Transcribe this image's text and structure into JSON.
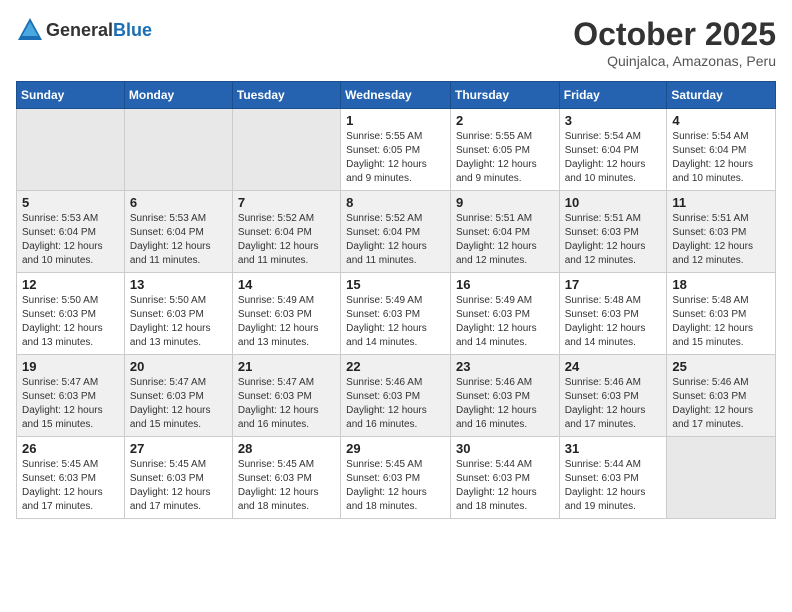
{
  "header": {
    "logo_general": "General",
    "logo_blue": "Blue",
    "title": "October 2025",
    "subtitle": "Quinjalca, Amazonas, Peru"
  },
  "days_of_week": [
    "Sunday",
    "Monday",
    "Tuesday",
    "Wednesday",
    "Thursday",
    "Friday",
    "Saturday"
  ],
  "weeks": [
    [
      {
        "day": "",
        "sunrise": "",
        "sunset": "",
        "daylight": ""
      },
      {
        "day": "",
        "sunrise": "",
        "sunset": "",
        "daylight": ""
      },
      {
        "day": "",
        "sunrise": "",
        "sunset": "",
        "daylight": ""
      },
      {
        "day": "1",
        "sunrise": "Sunrise: 5:55 AM",
        "sunset": "Sunset: 6:05 PM",
        "daylight": "Daylight: 12 hours and 9 minutes."
      },
      {
        "day": "2",
        "sunrise": "Sunrise: 5:55 AM",
        "sunset": "Sunset: 6:05 PM",
        "daylight": "Daylight: 12 hours and 9 minutes."
      },
      {
        "day": "3",
        "sunrise": "Sunrise: 5:54 AM",
        "sunset": "Sunset: 6:04 PM",
        "daylight": "Daylight: 12 hours and 10 minutes."
      },
      {
        "day": "4",
        "sunrise": "Sunrise: 5:54 AM",
        "sunset": "Sunset: 6:04 PM",
        "daylight": "Daylight: 12 hours and 10 minutes."
      }
    ],
    [
      {
        "day": "5",
        "sunrise": "Sunrise: 5:53 AM",
        "sunset": "Sunset: 6:04 PM",
        "daylight": "Daylight: 12 hours and 10 minutes."
      },
      {
        "day": "6",
        "sunrise": "Sunrise: 5:53 AM",
        "sunset": "Sunset: 6:04 PM",
        "daylight": "Daylight: 12 hours and 11 minutes."
      },
      {
        "day": "7",
        "sunrise": "Sunrise: 5:52 AM",
        "sunset": "Sunset: 6:04 PM",
        "daylight": "Daylight: 12 hours and 11 minutes."
      },
      {
        "day": "8",
        "sunrise": "Sunrise: 5:52 AM",
        "sunset": "Sunset: 6:04 PM",
        "daylight": "Daylight: 12 hours and 11 minutes."
      },
      {
        "day": "9",
        "sunrise": "Sunrise: 5:51 AM",
        "sunset": "Sunset: 6:04 PM",
        "daylight": "Daylight: 12 hours and 12 minutes."
      },
      {
        "day": "10",
        "sunrise": "Sunrise: 5:51 AM",
        "sunset": "Sunset: 6:03 PM",
        "daylight": "Daylight: 12 hours and 12 minutes."
      },
      {
        "day": "11",
        "sunrise": "Sunrise: 5:51 AM",
        "sunset": "Sunset: 6:03 PM",
        "daylight": "Daylight: 12 hours and 12 minutes."
      }
    ],
    [
      {
        "day": "12",
        "sunrise": "Sunrise: 5:50 AM",
        "sunset": "Sunset: 6:03 PM",
        "daylight": "Daylight: 12 hours and 13 minutes."
      },
      {
        "day": "13",
        "sunrise": "Sunrise: 5:50 AM",
        "sunset": "Sunset: 6:03 PM",
        "daylight": "Daylight: 12 hours and 13 minutes."
      },
      {
        "day": "14",
        "sunrise": "Sunrise: 5:49 AM",
        "sunset": "Sunset: 6:03 PM",
        "daylight": "Daylight: 12 hours and 13 minutes."
      },
      {
        "day": "15",
        "sunrise": "Sunrise: 5:49 AM",
        "sunset": "Sunset: 6:03 PM",
        "daylight": "Daylight: 12 hours and 14 minutes."
      },
      {
        "day": "16",
        "sunrise": "Sunrise: 5:49 AM",
        "sunset": "Sunset: 6:03 PM",
        "daylight": "Daylight: 12 hours and 14 minutes."
      },
      {
        "day": "17",
        "sunrise": "Sunrise: 5:48 AM",
        "sunset": "Sunset: 6:03 PM",
        "daylight": "Daylight: 12 hours and 14 minutes."
      },
      {
        "day": "18",
        "sunrise": "Sunrise: 5:48 AM",
        "sunset": "Sunset: 6:03 PM",
        "daylight": "Daylight: 12 hours and 15 minutes."
      }
    ],
    [
      {
        "day": "19",
        "sunrise": "Sunrise: 5:47 AM",
        "sunset": "Sunset: 6:03 PM",
        "daylight": "Daylight: 12 hours and 15 minutes."
      },
      {
        "day": "20",
        "sunrise": "Sunrise: 5:47 AM",
        "sunset": "Sunset: 6:03 PM",
        "daylight": "Daylight: 12 hours and 15 minutes."
      },
      {
        "day": "21",
        "sunrise": "Sunrise: 5:47 AM",
        "sunset": "Sunset: 6:03 PM",
        "daylight": "Daylight: 12 hours and 16 minutes."
      },
      {
        "day": "22",
        "sunrise": "Sunrise: 5:46 AM",
        "sunset": "Sunset: 6:03 PM",
        "daylight": "Daylight: 12 hours and 16 minutes."
      },
      {
        "day": "23",
        "sunrise": "Sunrise: 5:46 AM",
        "sunset": "Sunset: 6:03 PM",
        "daylight": "Daylight: 12 hours and 16 minutes."
      },
      {
        "day": "24",
        "sunrise": "Sunrise: 5:46 AM",
        "sunset": "Sunset: 6:03 PM",
        "daylight": "Daylight: 12 hours and 17 minutes."
      },
      {
        "day": "25",
        "sunrise": "Sunrise: 5:46 AM",
        "sunset": "Sunset: 6:03 PM",
        "daylight": "Daylight: 12 hours and 17 minutes."
      }
    ],
    [
      {
        "day": "26",
        "sunrise": "Sunrise: 5:45 AM",
        "sunset": "Sunset: 6:03 PM",
        "daylight": "Daylight: 12 hours and 17 minutes."
      },
      {
        "day": "27",
        "sunrise": "Sunrise: 5:45 AM",
        "sunset": "Sunset: 6:03 PM",
        "daylight": "Daylight: 12 hours and 17 minutes."
      },
      {
        "day": "28",
        "sunrise": "Sunrise: 5:45 AM",
        "sunset": "Sunset: 6:03 PM",
        "daylight": "Daylight: 12 hours and 18 minutes."
      },
      {
        "day": "29",
        "sunrise": "Sunrise: 5:45 AM",
        "sunset": "Sunset: 6:03 PM",
        "daylight": "Daylight: 12 hours and 18 minutes."
      },
      {
        "day": "30",
        "sunrise": "Sunrise: 5:44 AM",
        "sunset": "Sunset: 6:03 PM",
        "daylight": "Daylight: 12 hours and 18 minutes."
      },
      {
        "day": "31",
        "sunrise": "Sunrise: 5:44 AM",
        "sunset": "Sunset: 6:03 PM",
        "daylight": "Daylight: 12 hours and 19 minutes."
      },
      {
        "day": "",
        "sunrise": "",
        "sunset": "",
        "daylight": ""
      }
    ]
  ]
}
